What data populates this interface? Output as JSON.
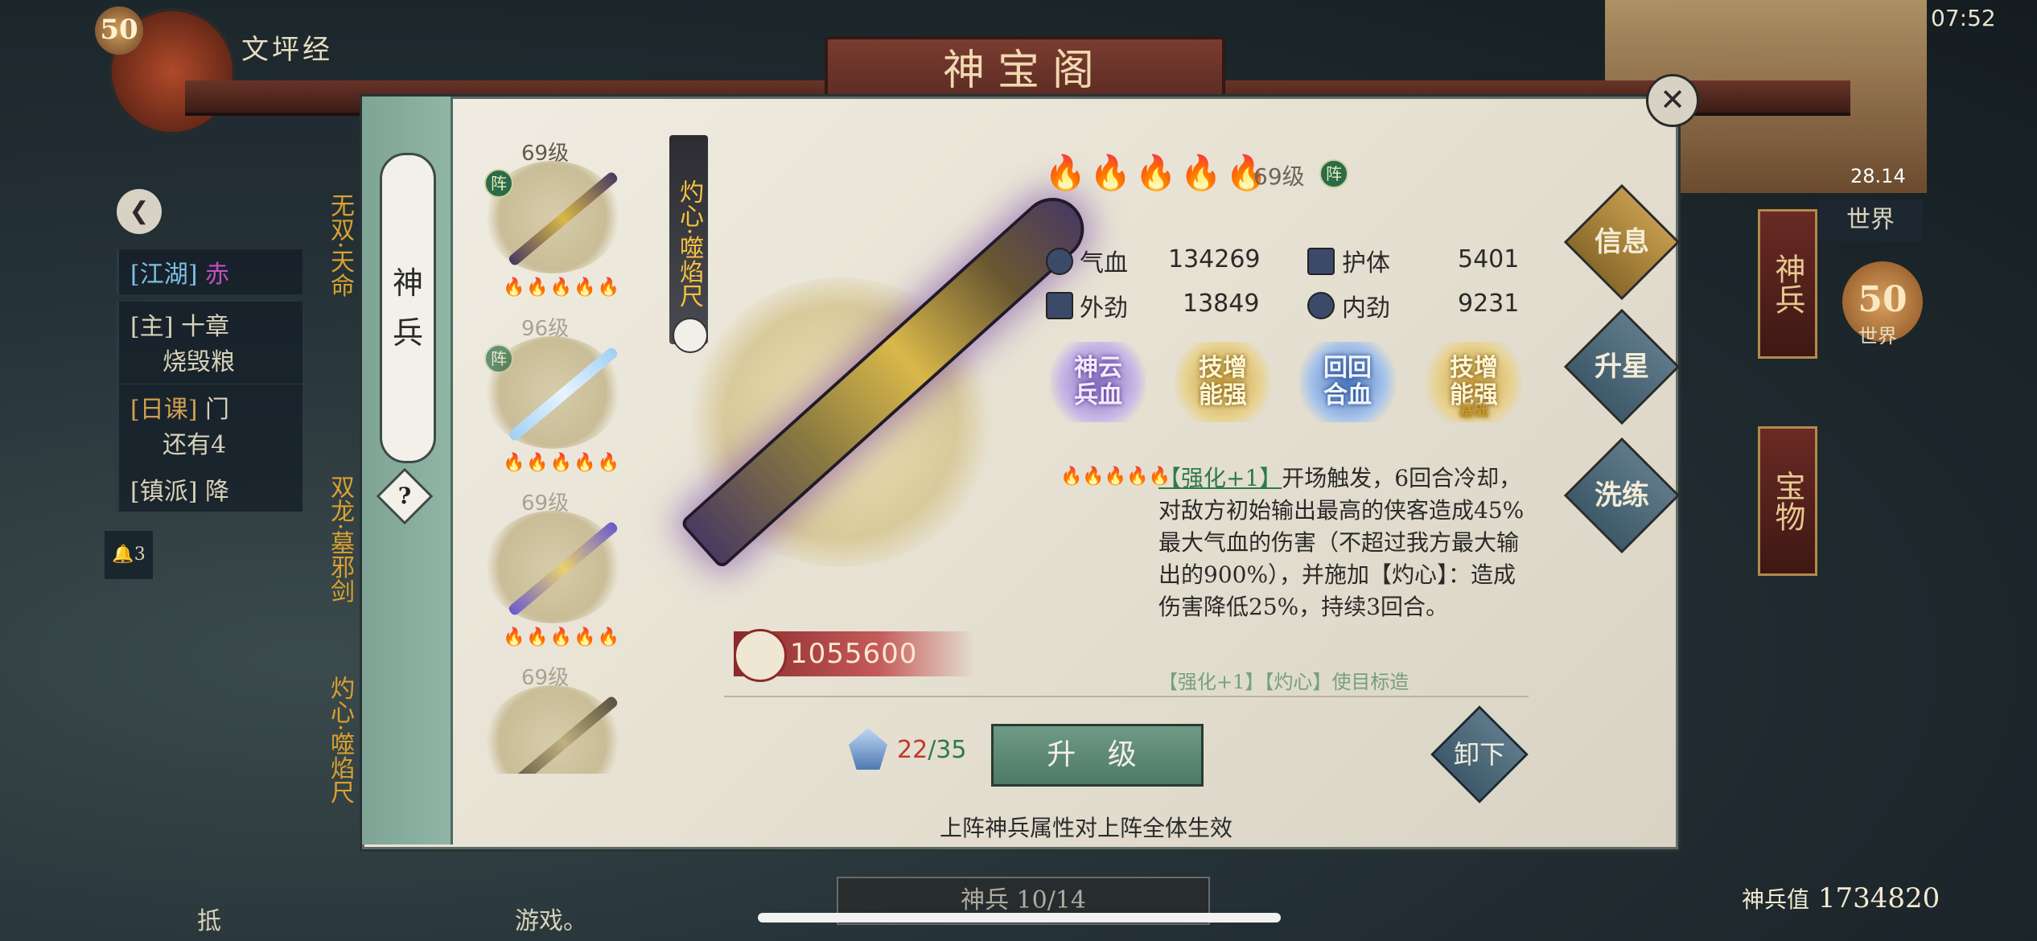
{
  "status_bar": {
    "time": "07:52"
  },
  "top_title": "神宝阁",
  "player": {
    "level": "50",
    "name": "文坪经"
  },
  "left_hud": {
    "quests": [
      {
        "tag": "[江湖]",
        "text": "赤"
      },
      {
        "tag": "[主]",
        "text": "十章",
        "sub": "烧毁粮"
      },
      {
        "tag": "[日课]",
        "text": "门",
        "sub": "还有4"
      },
      {
        "tag": "[镇派]",
        "text": "降"
      }
    ],
    "side_labels": [
      "无双·天命",
      "双龙·墓邪剑",
      "灼心·噬焰尺"
    ],
    "mail_count": "3",
    "chat_text": "抵",
    "chat_text2": "游戏。"
  },
  "side_tab": {
    "label_1": "神",
    "label_2": "兵",
    "help": "?"
  },
  "weapon_list": [
    {
      "level": "69级",
      "stars_on": 4,
      "stars_total": 5,
      "equipped": true,
      "badge": "阵"
    },
    {
      "level": "96级",
      "stars_on": 3,
      "stars_total": 5,
      "equipped": true,
      "badge": "阵"
    },
    {
      "level": "69级",
      "stars_on": 3,
      "stars_total": 5,
      "equipped": false
    },
    {
      "level": "69级",
      "stars_on": 0,
      "stars_total": 5,
      "equipped": false
    }
  ],
  "selected_weapon": {
    "name": "灼心·噬焰尺",
    "stars_on": 4,
    "stars_total": 5,
    "level": "69级",
    "badge": "阵",
    "power": "1055600",
    "stats": [
      {
        "label": "气血",
        "value": "134269",
        "icon": "heart-icon"
      },
      {
        "label": "护体",
        "value": "5401",
        "icon": "shield-icon"
      },
      {
        "label": "外劲",
        "value": "13849",
        "icon": "sword-icon"
      },
      {
        "label": "内劲",
        "value": "9231",
        "icon": "swirl-icon"
      }
    ],
    "skills": [
      {
        "line1": "神云",
        "line2": "兵血",
        "sub": ""
      },
      {
        "line1": "技增",
        "line2": "能强",
        "sub": ""
      },
      {
        "line1": "回回",
        "line2": "合血",
        "sub": ""
      },
      {
        "line1": "技增",
        "line2": "能强",
        "sub": "基础"
      }
    ],
    "description": {
      "tag": "【强化+1】",
      "text": "开场触发，6回合冷却，对敌方初始输出最高的侠客造成45%最大气血的伤害（不超过我方最大输出的900%），并施加【灼心】：造成伤害降低25%，持续3回合。",
      "next_line": "【强化+1】【灼心】使目标造"
    },
    "upgrade": {
      "current": "22",
      "slash": "/",
      "required": "35",
      "button": "升 级"
    },
    "unequip_label": "卸下",
    "footer_note": "上阵神兵属性对上阵全体生效"
  },
  "right_tabs": {
    "info": "信息",
    "star": "升星",
    "wash": "洗练"
  },
  "close_label": "✕",
  "right_hud": {
    "map_coord": "28.14",
    "world_button": "世界",
    "rank": "50",
    "rank_label": "世界",
    "vtab_1": "神兵",
    "vtab_2": "宝物"
  },
  "bottom": {
    "count_label": "神兵 10/14",
    "total_label": "神兵值",
    "total_value": "1734820"
  },
  "colors": {
    "accent_gold": "#e2b530",
    "panel_bg": "#ebe7da",
    "button_green": "#5e8a74",
    "text_red": "#c0392b",
    "text_green": "#2f7a4a"
  }
}
